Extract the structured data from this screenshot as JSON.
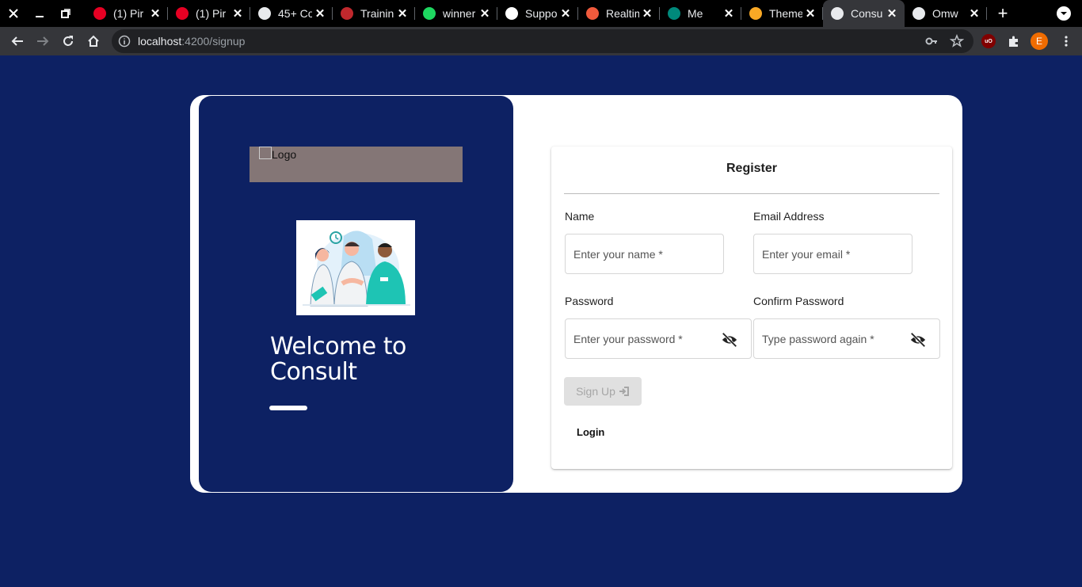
{
  "browser": {
    "tabs": [
      {
        "title": "(1) Pir",
        "icon": "pinterest-icon",
        "color": "#e60023"
      },
      {
        "title": "(1) Pir",
        "icon": "pinterest-icon",
        "color": "#e60023"
      },
      {
        "title": "45+ Co",
        "icon": "globe-icon",
        "color": "#e8eaed"
      },
      {
        "title": "Trainin",
        "icon": "shield-icon",
        "color": "#c0282d"
      },
      {
        "title": "winner",
        "icon": "bolt-icon",
        "color": "#1ed760"
      },
      {
        "title": "Suppo",
        "icon": "medium-icon",
        "color": "#ffffff"
      },
      {
        "title": "Realtim",
        "icon": "flame-icon",
        "color": "#f05a3c"
      },
      {
        "title": "Me",
        "icon": "meet-icon",
        "color": "#00897b"
      },
      {
        "title": "Theme",
        "icon": "badge-icon",
        "color": "#f9a825"
      },
      {
        "title": "Consu",
        "icon": "angular-icon",
        "color": "#e8eaed",
        "active": true
      },
      {
        "title": "Omw",
        "icon": "github-icon",
        "color": "#e8eaed"
      }
    ],
    "url_host": "localhost",
    "url_path": ":4200/signup",
    "profile_initial": "E"
  },
  "left": {
    "logo_alt": "Logo",
    "welcome_title": "Welcome to Consult"
  },
  "form": {
    "title": "Register",
    "name_label": "Name",
    "name_placeholder": "Enter your name *",
    "email_label": "Email Address",
    "email_placeholder": "Enter your email *",
    "password_label": "Password",
    "password_placeholder": "Enter your password *",
    "confirm_label": "Confirm Password",
    "confirm_placeholder": "Type password again *",
    "signup_label": "Sign Up",
    "login_label": "Login"
  },
  "colors": {
    "page_bg": "#0d2163",
    "logo_bg": "#847676",
    "button_disabled": "#e0e0e0"
  }
}
